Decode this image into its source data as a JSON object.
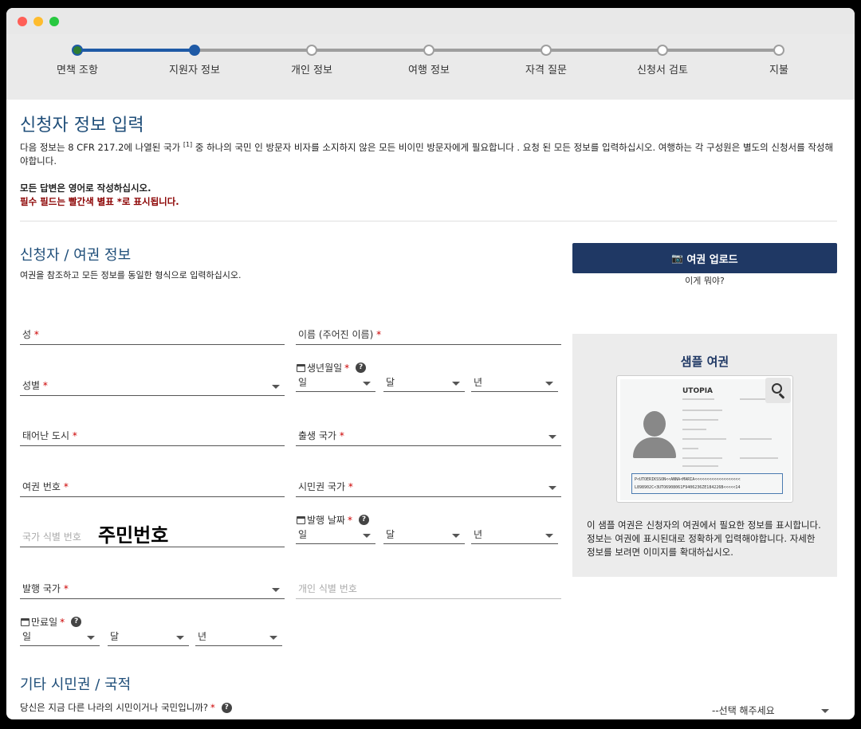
{
  "steps": [
    "면책 조항",
    "지원자 정보",
    "개인 정보",
    "여행 정보",
    "자격 질문",
    "신청서 검토",
    "지불"
  ],
  "page": {
    "title": "신청자 정보 입력",
    "intro": "다음 정보는 8 CFR 217.2에 나열된 국가",
    "intro_sup": "[1]",
    "intro_rest": " 중 하나의 국민 인 방문자 비자를 소지하지 않은 모든 비이민 방문자에게 필요합니다 . 요청 된 모든 정보를 입력하십시오. 여행하는 각 구성원은 별도의 신청서를 작성해야합니다.",
    "note_english": "모든 답변은 영어로 작성하십시오.",
    "note_required": "필수 필드는 빨간색 별표 *로 표시됩니다."
  },
  "applicant": {
    "section_title": "신청자 / 여권 정보",
    "section_desc": "여권을 참조하고 모든 정보를 동일한 형식으로 입력하십시오.",
    "upload_button": "여권 업로드",
    "what_link": "이게 뭐야?",
    "surname": "성",
    "given_name": "이름 (주어진 이름)",
    "birth_date_label": "생년월일",
    "gender": "성별",
    "day": "일",
    "month": "달",
    "year": "년",
    "birth_city": "태어난 도시",
    "birth_country": "출생 국가",
    "passport_number": "여권 번호",
    "citizenship_country": "시민권 국가",
    "national_id_placeholder": "국가 식별 번호",
    "national_id_overlay": "주민번호",
    "issue_date_label": "발행 날짜",
    "issuing_country": "발행 국가",
    "personal_id_placeholder": "개인 식별 번호",
    "expiry_date_label": "만료일",
    "required_mark": "*",
    "help_mark": "?"
  },
  "sample": {
    "title": "샘플 여권",
    "passport_country": "UTOPIA",
    "mrz_line1": "P<UTOERIKSSON<<ANNA<MARIA<<<<<<<<<<<<<<<<<<<",
    "mrz_line2": "L898902C<3UTO6908061F9406236ZE184226B<<<<<14",
    "description": "이 샘플 여권은 신청자의 여권에서 필요한 정보를 표시합니다. 정보는 여권에 표시된대로 정확하게 입력해야합니다. 자세한 정보를 보려면 이미지를 확대하십시오."
  },
  "other_citizenship": {
    "section_title": "기타 시민권 / 국적",
    "question": "당신은 지금 다른 나라의 시민이거나 국민입니까?",
    "select_placeholder": "--선택 해주세요"
  },
  "colors": {
    "accent": "#1f5aa6",
    "heading": "#1f4e79",
    "button": "#1f3864",
    "required": "#cc0000"
  }
}
